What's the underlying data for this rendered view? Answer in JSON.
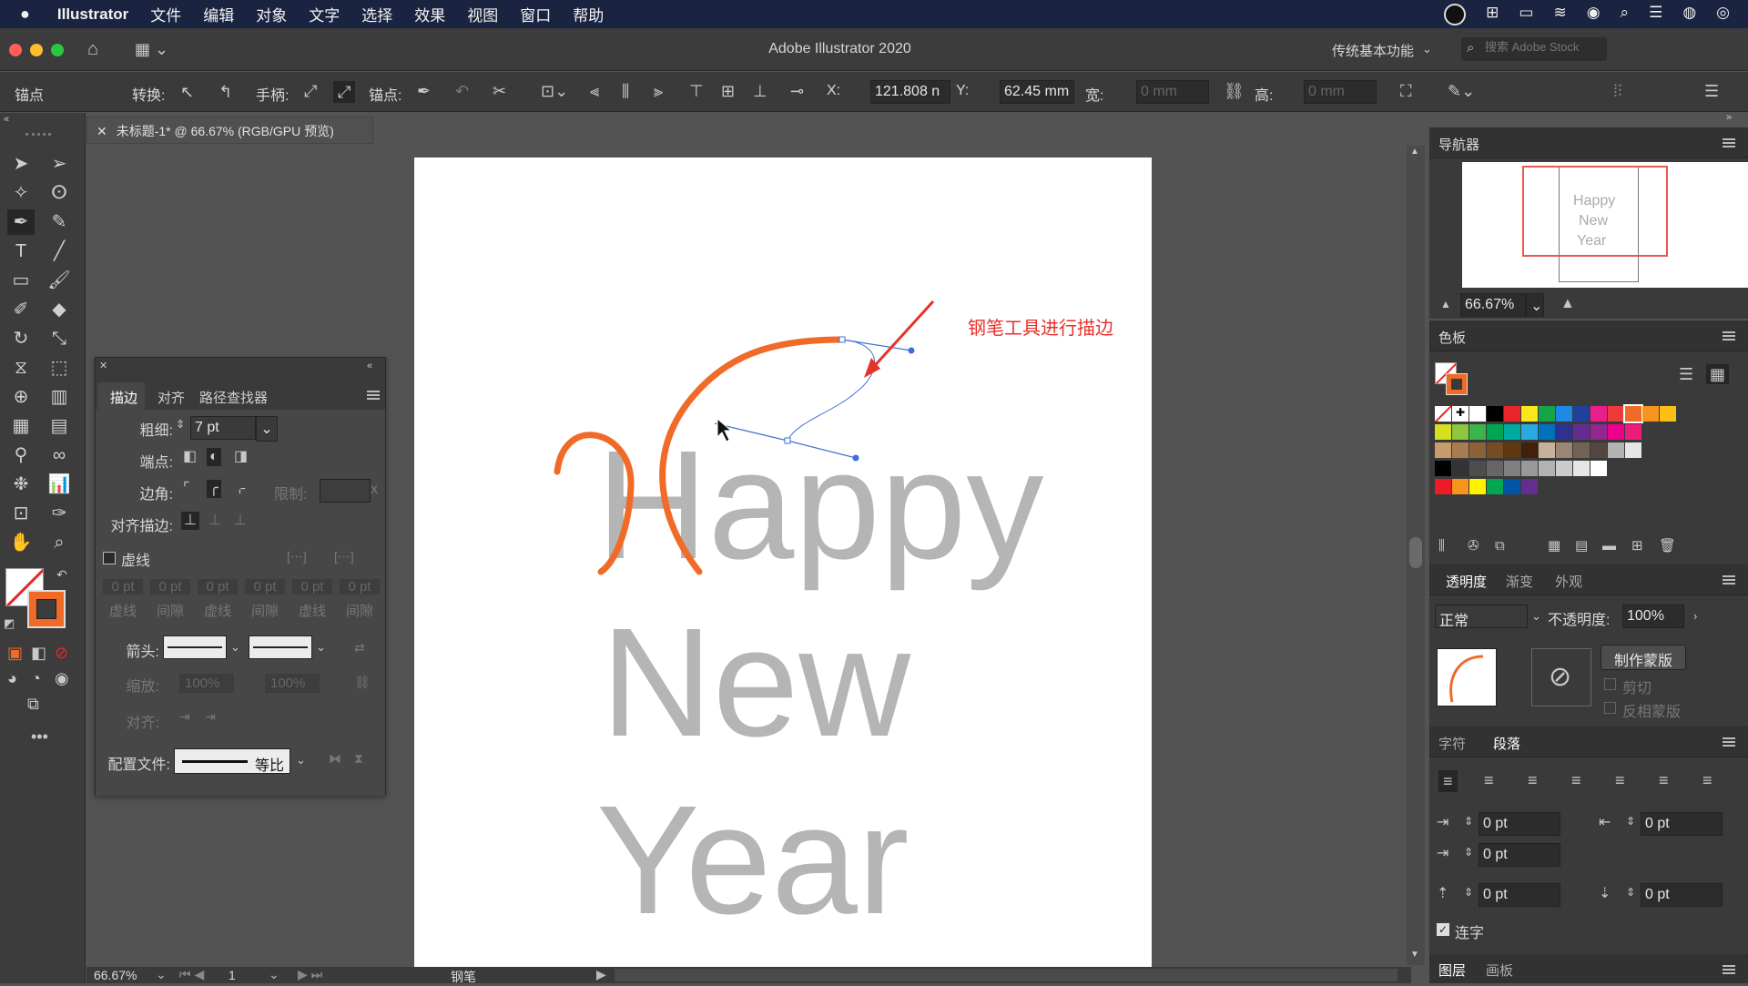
{
  "menubar": {
    "apple_icon": "apple-logo",
    "items": [
      "Illustrator",
      "文件",
      "编辑",
      "对象",
      "文字",
      "选择",
      "效果",
      "视图",
      "窗口",
      "帮助"
    ]
  },
  "titlebar": {
    "title": "Adobe Illustrator 2020",
    "workspace": "传统基本功能",
    "search_placeholder": "搜索 Adobe Stock"
  },
  "controlbar": {
    "selection_label": "锚点",
    "convert_label": "转换:",
    "handles_label": "手柄:",
    "anchors_label": "锚点:",
    "x_label": "X:",
    "x_value": "121.808 n",
    "y_label": "Y:",
    "y_value": "62.45 mm",
    "width_label": "宽:",
    "width_value": "0 mm",
    "height_label": "高:",
    "height_value": "0 mm"
  },
  "document": {
    "tab_label": "未标题-1* @ 66.67% (RGB/GPU 预览)",
    "annotation": "钢笔工具进行描边",
    "artwork_lines": [
      "Happy",
      "New",
      "Year"
    ],
    "accent_color": "#f06a28",
    "text_color": "#b5b5b5",
    "annotation_color": "#e8312a"
  },
  "stroke_panel": {
    "tabs": [
      "描边",
      "对齐",
      "路径查找器"
    ],
    "weight_label": "粗细:",
    "weight_value": "7 pt",
    "cap_label": "端点:",
    "corner_label": "边角:",
    "limit_label": "限制:",
    "limit_suffix": "x",
    "align_label": "对齐描边:",
    "dashed_label": "虚线",
    "dash_values": [
      "0 pt",
      "0 pt",
      "0 pt",
      "0 pt",
      "0 pt",
      "0 pt"
    ],
    "dash_labels": [
      "虚线",
      "间隙",
      "虚线",
      "间隙",
      "虚线",
      "间隙"
    ],
    "arrow_label": "箭头:",
    "scale_label": "缩放:",
    "scale_values": [
      "100%",
      "100%"
    ],
    "align_arrow_label": "对齐:",
    "profile_label": "配置文件:",
    "profile_value": "等比"
  },
  "navigator": {
    "title": "导航器",
    "zoom": "66.67%",
    "thumb_lines": [
      "Happy",
      "New",
      "Year"
    ]
  },
  "swatches": {
    "title": "色板",
    "rows": [
      [
        "#ffffff",
        "#000000",
        "#e8262a",
        "#f7e81c",
        "#16a34a",
        "#1e88e5",
        "#21409a",
        "#e91e8c",
        "#ee3a3a",
        "#f06a28",
        "#f7941d",
        "#fbc015"
      ],
      [
        "#d7df21",
        "#8dc63f",
        "#39b54a",
        "#00a651",
        "#00a99d",
        "#29abe2",
        "#0072bc",
        "#2e3192",
        "#662d91",
        "#92278f",
        "#ec008c",
        "#ed1e79"
      ],
      [
        "#c69c6d",
        "#a67c52",
        "#8c6239",
        "#754c24",
        "#603913",
        "#42210b",
        "#c7b299",
        "#998675",
        "#736357",
        "#534741",
        "#b3b3b3",
        "#e6e6e6"
      ],
      [
        "#000000",
        "#333333",
        "#4d4d4d",
        "#666666",
        "#808080",
        "#999999",
        "#b3b3b3",
        "#cccccc",
        "#e6e6e6",
        "#ffffff"
      ],
      [
        "#ed1c24",
        "#f7941d",
        "#fff200",
        "#00a651",
        "#0054a6",
        "#662d91"
      ]
    ]
  },
  "transparency": {
    "tabs": [
      "透明度",
      "渐变",
      "外观"
    ],
    "mode": "正常",
    "opacity_label": "不透明度:",
    "opacity_value": "100%",
    "make_mask": "制作蒙版",
    "clip_label": "剪切",
    "invert_label": "反相蒙版"
  },
  "paragraph": {
    "tabs": [
      "字符",
      "段落"
    ],
    "values": [
      "0 pt",
      "0 pt",
      "0 pt",
      "0 pt",
      "0 pt"
    ],
    "hyphenate_label": "连字"
  },
  "bottom_tabs": [
    "图层",
    "画板"
  ],
  "status": {
    "zoom": "66.67%",
    "page": "1",
    "tool": "钢笔"
  }
}
